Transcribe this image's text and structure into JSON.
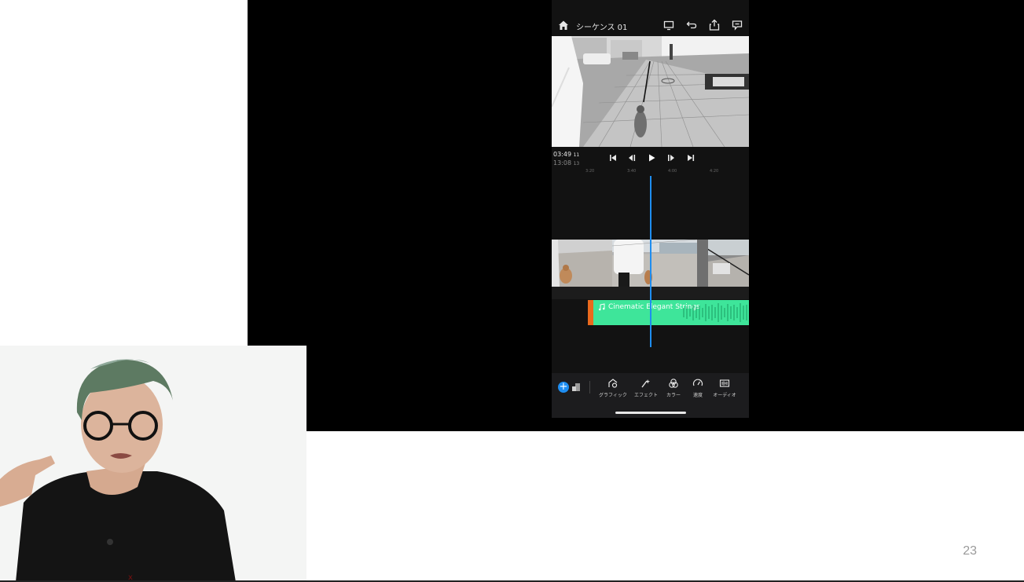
{
  "slide": {
    "page_number": "23"
  },
  "editor": {
    "sequence_title": "シーケンス 01",
    "topbar_icons": [
      "home-icon",
      "display-icon",
      "undo-icon",
      "share-icon",
      "comment-icon"
    ],
    "timecode_current": "03:49",
    "timecode_current_frames": "11",
    "timecode_duration": "13:08",
    "timecode_duration_frames": "13",
    "playback_controls": [
      "skip-to-start-icon",
      "step-back-icon",
      "play-icon",
      "step-forward-icon",
      "skip-to-end-icon"
    ],
    "ruler_ticks": [
      "3:20",
      "3:40",
      "4:00",
      "4:20"
    ],
    "audio_clip_title": "Cinematic Elegant Strings",
    "tools": [
      {
        "label": "グラフィック",
        "icon": "graphics-icon"
      },
      {
        "label": "エフェクト",
        "icon": "effects-icon"
      },
      {
        "label": "カラー",
        "icon": "color-icon"
      },
      {
        "label": "速度",
        "icon": "speed-icon"
      },
      {
        "label": "オーディオ",
        "icon": "audio-icon"
      }
    ],
    "add_button_label": "+",
    "colors": {
      "accent": "#1e8df0",
      "audio_clip": "#3ee59a",
      "audio_handle": "#ea6a1d",
      "panel_background": "#121212"
    }
  }
}
